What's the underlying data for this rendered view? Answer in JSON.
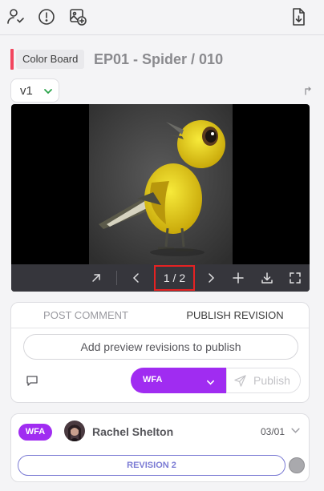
{
  "header": {
    "icons": [
      "assign-user-icon",
      "alert-circle-icon",
      "add-image-icon",
      "file-download-icon"
    ]
  },
  "task": {
    "type_label": "Color Board",
    "shot_title": "EP01 - Spider / 010",
    "accent_color": "#f2455e"
  },
  "version": {
    "selected": "v1"
  },
  "viewer": {
    "page_indicator": "1 / 2"
  },
  "publish_panel": {
    "tabs": [
      {
        "label": "POST COMMENT"
      },
      {
        "label": "PUBLISH REVISION"
      }
    ],
    "add_preview_label": "Add preview revisions to publish",
    "status_value": "WFA",
    "publish_label": "Publish",
    "status_color": "#a02cf1"
  },
  "revisions": [
    {
      "status": "WFA",
      "author": "Rachel Shelton",
      "date": "03/01",
      "revision_label": "REVISION 2"
    }
  ]
}
